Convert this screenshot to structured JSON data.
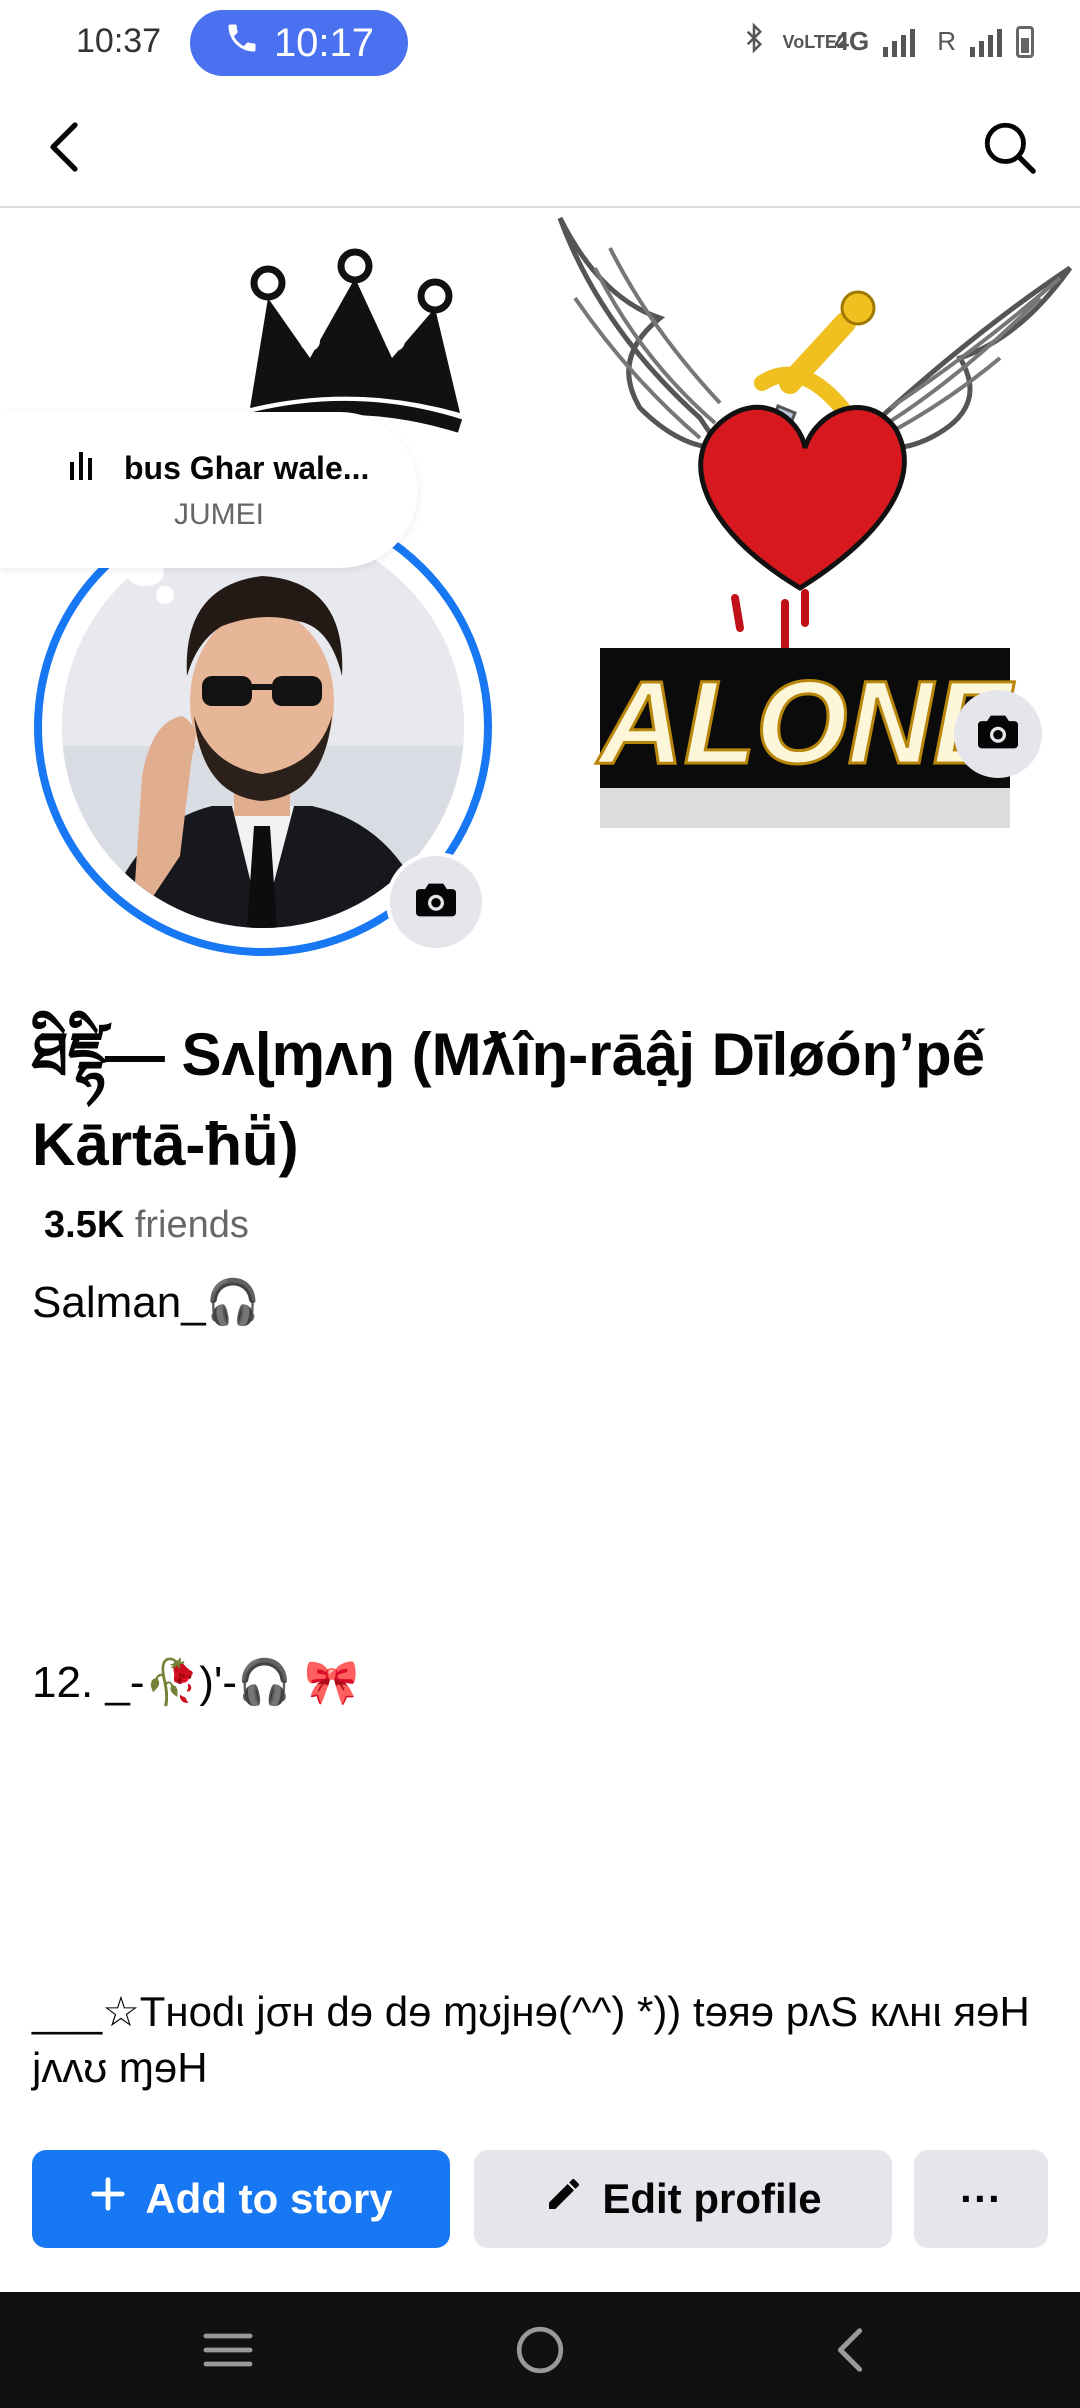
{
  "status_bar": {
    "time": "10:37",
    "call_time": "10:17",
    "network_labels": [
      "VoLTE2",
      "4G",
      "R"
    ]
  },
  "nav": {
    "back_icon": "back-arrow-icon",
    "search_icon": "search-icon"
  },
  "cover": {
    "text": "ALONE"
  },
  "music": {
    "title": "bus Ghar wale...",
    "artist": "JUMEI"
  },
  "profile": {
    "name": "ཐིཛྷི— Sʌɭɱʌŋ (Mƛîŋ-rāậj Dīløóŋ’pế Kārtā-ħṻ)",
    "friends_count": "3.5K",
    "friends_label": "friends",
    "bio_line1": "Salman_🎧",
    "bio_line2": "12. _-🥀)'-🎧 🎀",
    "bio_line3": "___☆Tнodι jσн dɘ dɘ ɱʊjнɘ(^^) *)) tɘяɘ pʌS кʌнι яɘH jʌʌʊ ɱɘH"
  },
  "actions": {
    "add_story": "Add to story",
    "edit_profile": "Edit profile",
    "more": "···"
  },
  "colors": {
    "primary": "#1877f2",
    "secondary_bg": "#e4e6eb",
    "call_pill": "#4a72f0"
  }
}
